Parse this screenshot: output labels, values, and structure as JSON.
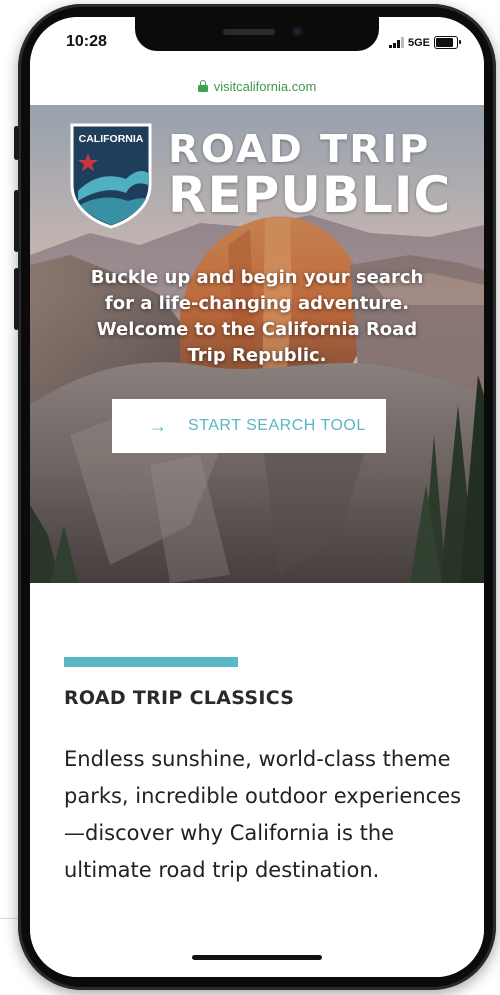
{
  "status_bar": {
    "time": "10:28",
    "network": "5GE"
  },
  "browser": {
    "url": "visitcalifornia.com"
  },
  "hero": {
    "badge_text": "CALIFORNIA",
    "brand_line1": "ROAD TRIP",
    "brand_line2": "REPUBLIC",
    "tagline": "Buckle up and begin your search for a life-changing adventure. Welcome to the California Road Trip Republic.",
    "cta_label": "START SEARCH TOOL"
  },
  "section": {
    "title": "ROAD TRIP CLASSICS",
    "body": "Endless sunshine, world-class theme parks, incredible outdoor experiences—discover why California is the ultimate road trip destination."
  },
  "colors": {
    "accent": "#5ab7c6",
    "badge_navy": "#1f3e5c",
    "badge_teal": "#4fb0c2",
    "star_red": "#c8373d",
    "url_green": "#3c9a4a"
  },
  "icons": {
    "lock": "lock-icon",
    "arrow": "arrow-right-icon",
    "signal": "signal-icon",
    "battery": "battery-icon"
  }
}
